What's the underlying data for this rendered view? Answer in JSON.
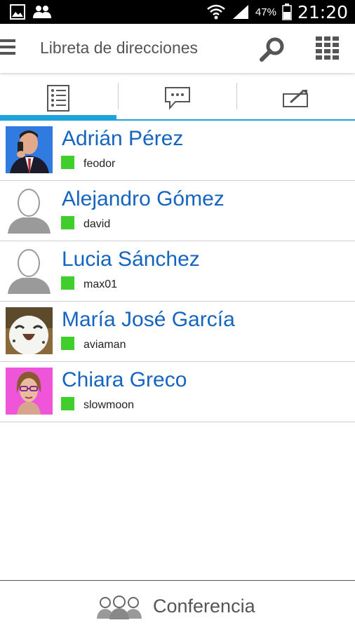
{
  "status_bar": {
    "battery_percent": "47%",
    "time": "21:20",
    "icons": [
      "gallery-icon",
      "contacts-icon",
      "wifi-icon",
      "signal-icon",
      "battery-icon"
    ]
  },
  "app_bar": {
    "title": "Libreta de direcciones",
    "icons": [
      "menu-icon",
      "search-icon",
      "dialpad-icon"
    ]
  },
  "tabs": [
    {
      "icon": "address-book-icon",
      "selected": true
    },
    {
      "icon": "chat-icon",
      "selected": false
    },
    {
      "icon": "call-log-icon",
      "selected": false
    }
  ],
  "contacts": [
    {
      "name": "Adrián Pérez",
      "username": "feodor",
      "status_color": "#3fce2c",
      "avatar": "photo-man-phone"
    },
    {
      "name": "Alejandro Gómez",
      "username": "david",
      "status_color": "#3fce2c",
      "avatar": "placeholder"
    },
    {
      "name": "Lucia Sánchez",
      "username": "max01",
      "status_color": "#3fce2c",
      "avatar": "placeholder"
    },
    {
      "name": "María José García",
      "username": "aviaman",
      "status_color": "#3fce2c",
      "avatar": "photo-owl"
    },
    {
      "name": "Chiara Greco",
      "username": "slowmoon",
      "status_color": "#3fce2c",
      "avatar": "photo-woman-glasses"
    }
  ],
  "bottom_bar": {
    "label": "Conferencia",
    "icon": "conference-icon"
  },
  "colors": {
    "accent": "#1fa3dd",
    "name_text": "#1565c0",
    "online": "#3fce2c"
  }
}
